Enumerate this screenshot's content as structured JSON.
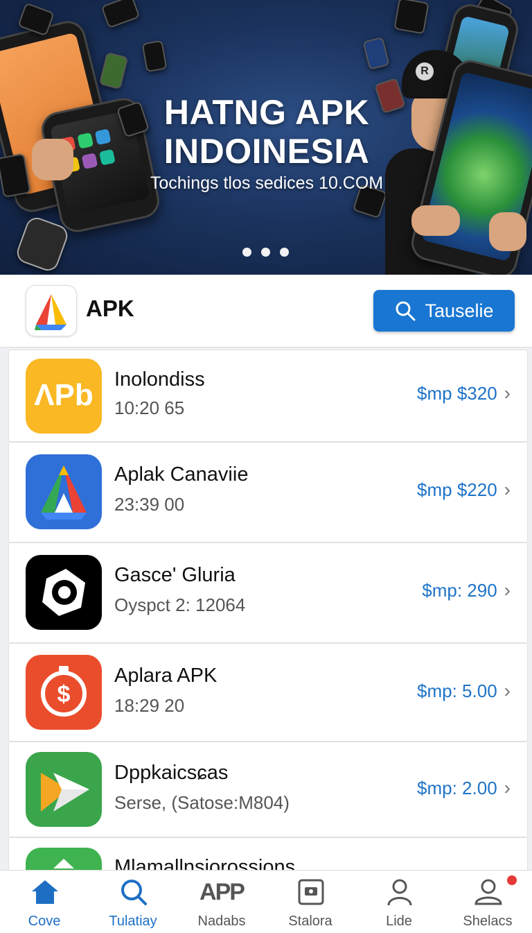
{
  "banner": {
    "title_line1": "HATNG APK",
    "title_line2": "INDOINESIA",
    "subtitle": "Tochings tlos sedices 10.COM",
    "pages": 3,
    "cap_logo": "R"
  },
  "header": {
    "brand": "APK",
    "search_label": "Tauselie"
  },
  "apps": [
    {
      "name": "Inolondiss",
      "sub": "10:20 65",
      "price": "$mp $320",
      "icon": "app-ab-icon",
      "icon_text": "ΛPb"
    },
    {
      "name": "Aplak Canaviie",
      "sub": "23:39 00",
      "price": "$mp $220",
      "icon": "app-triangle-icon"
    },
    {
      "name": "Gasce' Gluria",
      "sub": "Oyspct 2: 12064",
      "price": "$mp: 290",
      "icon": "app-camera-icon"
    },
    {
      "name": "Aplara APK",
      "sub": "18:29 20",
      "price": "$mp: 5.00",
      "icon": "app-dollar-timer-icon"
    },
    {
      "name": "Dppkaicsɕas",
      "sub": "Serse, (Satose:M804)",
      "price": "$mp: 2.00",
      "icon": "app-play-arrow-icon"
    },
    {
      "name": "Mlamallnsiorossions",
      "sub": "",
      "price": "",
      "icon": "app-green-icon"
    }
  ],
  "nav": [
    {
      "label": "Cove",
      "icon": "home-icon"
    },
    {
      "label": "Tulatiay",
      "icon": "search-icon"
    },
    {
      "label": "Nadabs",
      "icon": "app-text-icon",
      "icon_text": "APP"
    },
    {
      "label": "Stalora",
      "icon": "storage-icon"
    },
    {
      "label": "Lide",
      "icon": "person-icon"
    },
    {
      "label": "Shelacs",
      "icon": "profile-notification-icon"
    }
  ],
  "colors": {
    "accent": "#1976d2",
    "price": "#1e73c8",
    "active_nav": "#1e6fc4",
    "notification": "#e53935"
  }
}
